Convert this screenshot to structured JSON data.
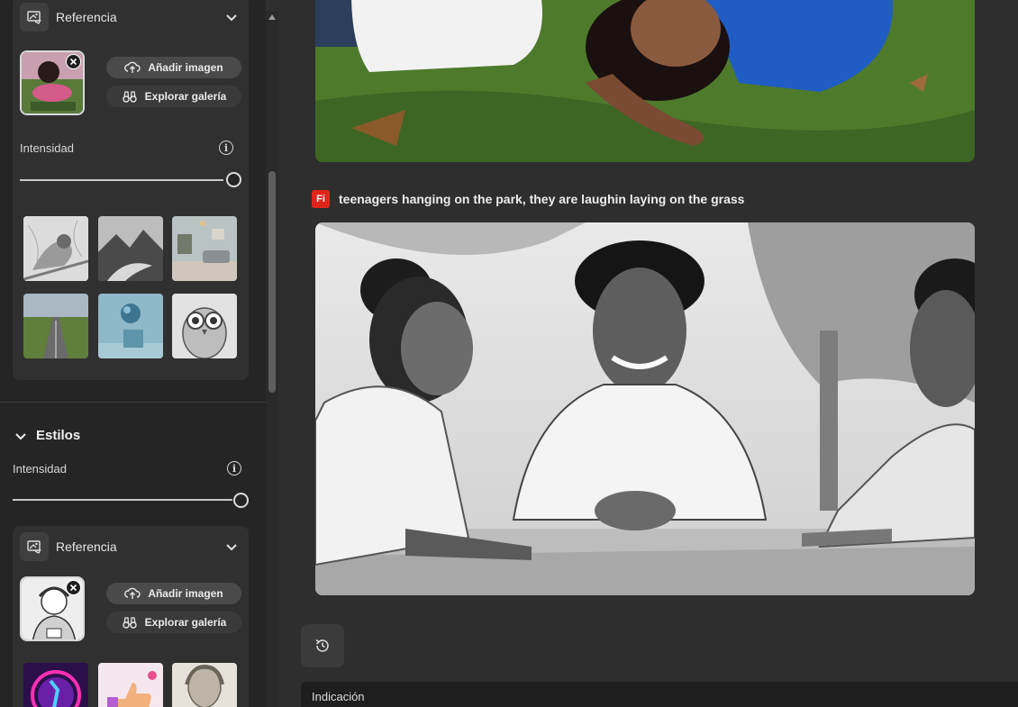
{
  "left_panel": {
    "reference_card_1": {
      "title": "Referencia",
      "add_image": "Añadir imagen",
      "explore_gallery": "Explorar galería",
      "intensity_label": "Intensidad",
      "intensity_value": 1.0,
      "gallery_items": [
        "bird-sketch",
        "mountain-lake",
        "living-room",
        "road-field",
        "sphere-cube",
        "owl-sketch"
      ]
    },
    "styles_section": {
      "title": "Estilos",
      "intensity_label": "Intensidad",
      "intensity_value": 1.0
    },
    "reference_card_2": {
      "title": "Referencia",
      "add_image": "Añadir imagen",
      "explore_gallery": "Explorar galería",
      "gallery_items": [
        "neon-figure",
        "thumbs-up",
        "statue-bust"
      ]
    }
  },
  "main": {
    "prompt_badge": "Fi",
    "prompt_text": "teenagers hanging on the park, they are laughin laying on the grass",
    "input_label": "Indicación"
  },
  "colors": {
    "firefly_red": "#e1251b",
    "panel_bg": "#252525",
    "card_bg": "#303030",
    "main_bg": "#2e2e2e"
  }
}
